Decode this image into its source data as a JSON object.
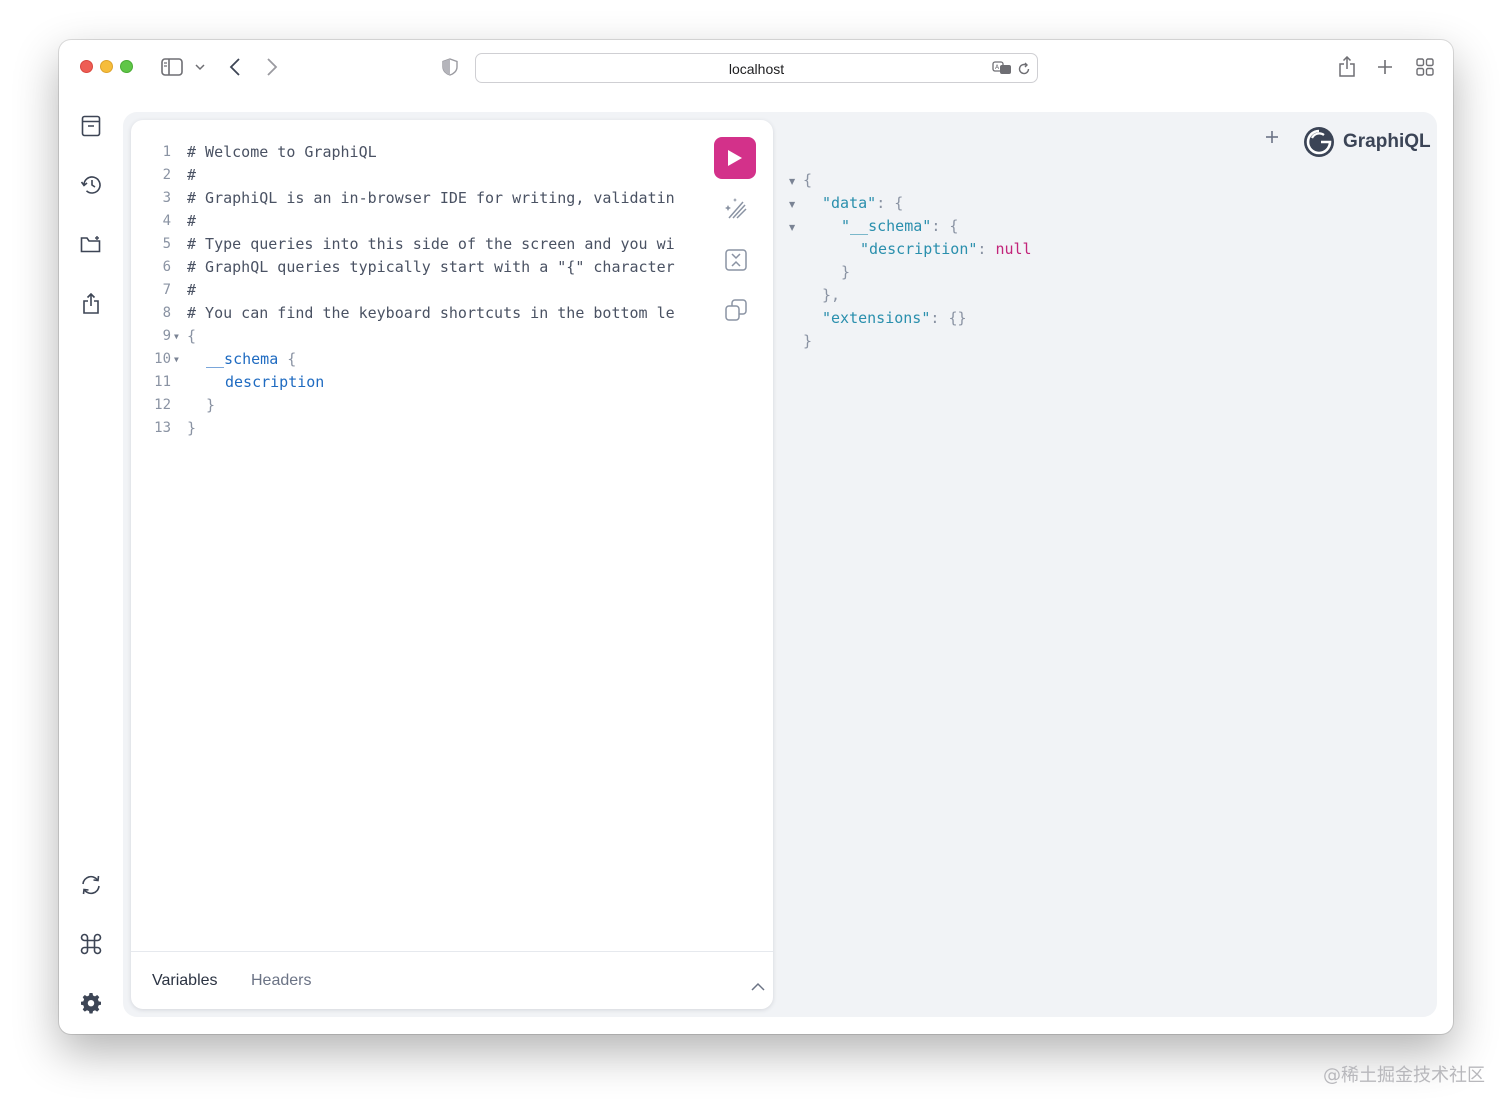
{
  "browser": {
    "url": "localhost",
    "icons": [
      "sidebar-icon",
      "chevron-down-icon",
      "back-icon",
      "forward-icon",
      "shield-icon",
      "translate-icon",
      "reload-icon",
      "share-icon",
      "new-tab-icon",
      "tab-overview-icon"
    ]
  },
  "sidebar": {
    "items": [
      {
        "icon": "docs-icon"
      },
      {
        "icon": "history-icon"
      },
      {
        "icon": "explorer-icon"
      },
      {
        "icon": "export-icon"
      }
    ],
    "bottom_items": [
      {
        "icon": "refresh-icon"
      },
      {
        "icon": "command-icon"
      },
      {
        "icon": "gear-icon"
      }
    ]
  },
  "editor": {
    "lines": [
      {
        "num": "1",
        "text": "# Welcome to GraphiQL"
      },
      {
        "num": "2",
        "text": "#"
      },
      {
        "num": "3",
        "text": "# GraphiQL is an in-browser IDE for writing, validatin"
      },
      {
        "num": "4",
        "text": "#"
      },
      {
        "num": "5",
        "text": "# Type queries into this side of the screen and you wi"
      },
      {
        "num": "6",
        "text": "# GraphQL queries typically start with a \"{\" character"
      },
      {
        "num": "7",
        "text": "#"
      },
      {
        "num": "8",
        "text": "# You can find the keyboard shortcuts in the bottom le"
      },
      {
        "num": "9",
        "text": "{"
      },
      {
        "num": "10",
        "text": "__schema",
        "brace": "{"
      },
      {
        "num": "11",
        "text": "description"
      },
      {
        "num": "12",
        "text": "}"
      },
      {
        "num": "13",
        "text": "}"
      }
    ],
    "tabs": {
      "variables": "Variables",
      "headers": "Headers"
    }
  },
  "result": {
    "open_brace": "{",
    "data_key": "\"data\"",
    "schema_key": "\"__schema\"",
    "description_key": "\"description\"",
    "description_value": "null",
    "close_inner": "}",
    "close_data": "},",
    "extensions_key": "\"extensions\"",
    "extensions_value": "{}",
    "close_root": "}",
    "colon_brace": ": {",
    "colon": ": "
  },
  "brand": {
    "name": "GraphiQL",
    "accent": "#d3318a"
  },
  "watermark": "@稀土掘金技术社区"
}
